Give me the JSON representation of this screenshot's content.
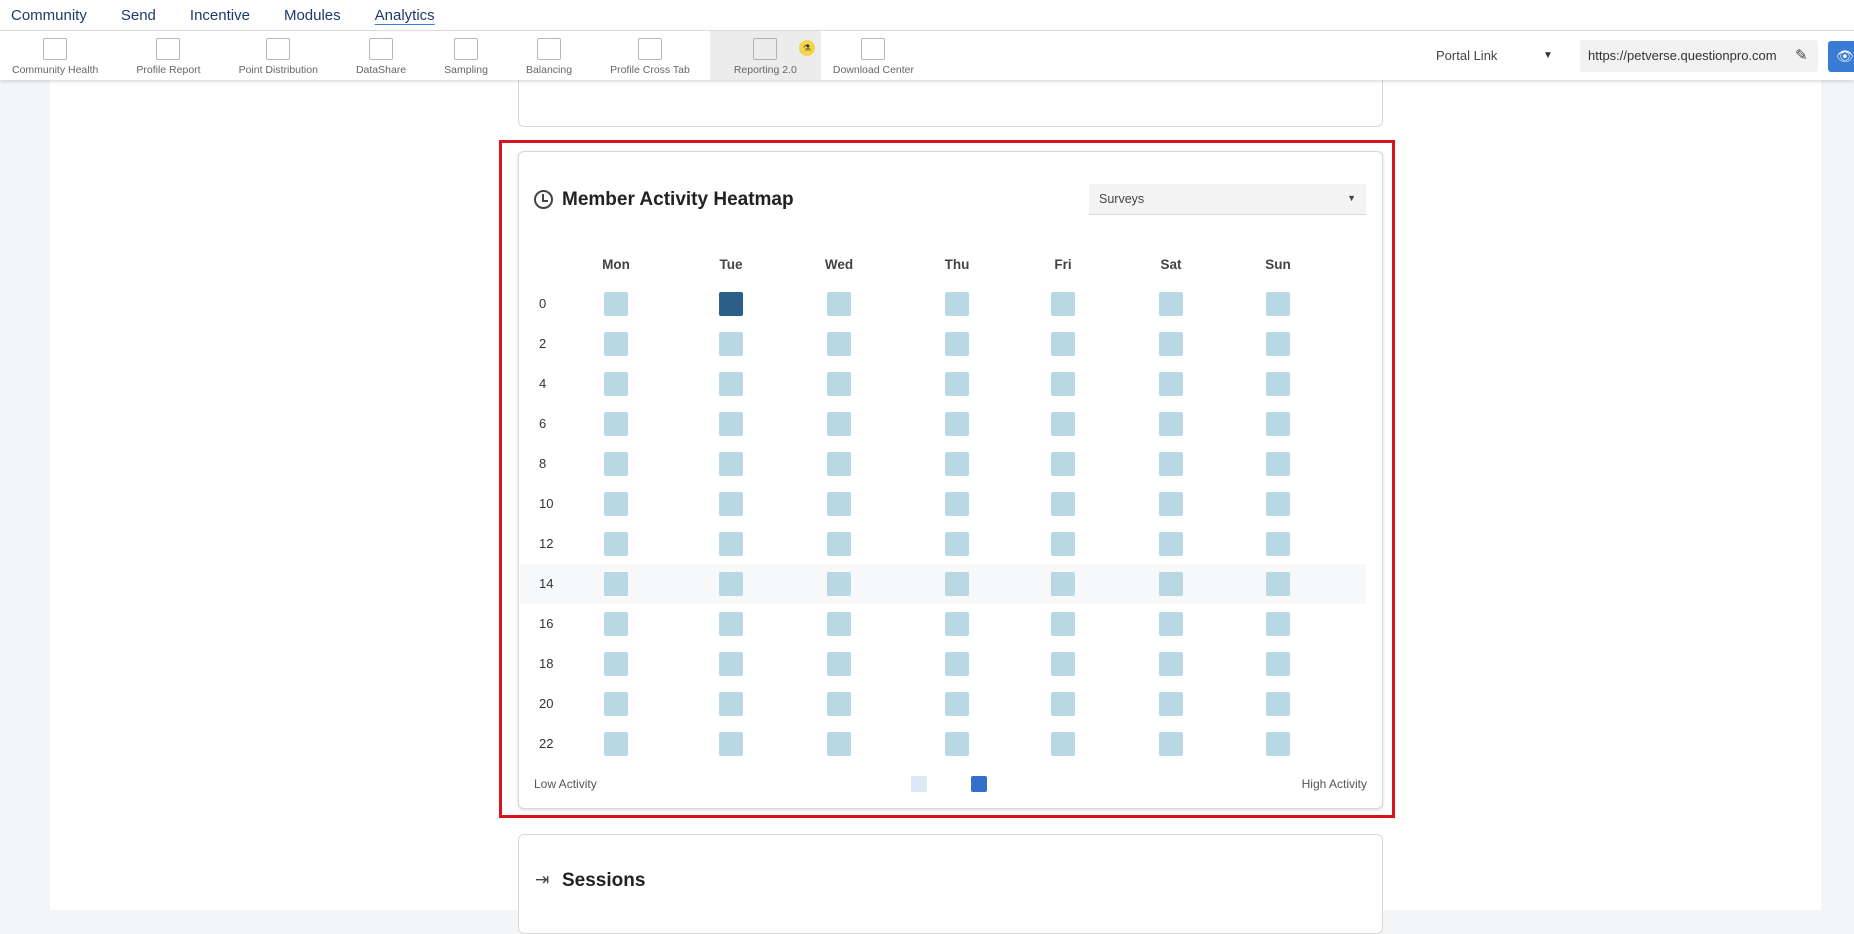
{
  "topnav": {
    "items": [
      "Community",
      "Send",
      "Incentive",
      "Modules",
      "Analytics"
    ],
    "active": "Analytics"
  },
  "toolbar": {
    "items": [
      "Community Health",
      "Profile Report",
      "Point Distribution",
      "DataShare",
      "Sampling",
      "Balancing",
      "Profile Cross Tab",
      "Reporting 2.0",
      "Download Center"
    ],
    "active": "Reporting 2.0"
  },
  "portal": {
    "label": "Portal Link",
    "url": "https://petverse.questionpro.com"
  },
  "heatmap_card": {
    "title": "Member Activity Heatmap",
    "select_value": "Surveys"
  },
  "sessions_card": {
    "title": "Sessions"
  },
  "chart_data": {
    "type": "heatmap",
    "title": "Member Activity Heatmap",
    "x": [
      "Mon",
      "Tue",
      "Wed",
      "Thu",
      "Fri",
      "Sat",
      "Sun"
    ],
    "y": [
      "0",
      "2",
      "4",
      "6",
      "8",
      "10",
      "12",
      "14",
      "16",
      "18",
      "20",
      "22"
    ],
    "values": [
      [
        0,
        1,
        0,
        0,
        0,
        0,
        0
      ],
      [
        0,
        0,
        0,
        0,
        0,
        0,
        0
      ],
      [
        0,
        0,
        0,
        0,
        0,
        0,
        0
      ],
      [
        0,
        0,
        0,
        0,
        0,
        0,
        0
      ],
      [
        0,
        0,
        0,
        0,
        0,
        0,
        0
      ],
      [
        0,
        0,
        0,
        0,
        0,
        0,
        0
      ],
      [
        0,
        0,
        0,
        0,
        0,
        0,
        0
      ],
      [
        0,
        0,
        0,
        0,
        0,
        0,
        0
      ],
      [
        0,
        0,
        0,
        0,
        0,
        0,
        0
      ],
      [
        0,
        0,
        0,
        0,
        0,
        0,
        0
      ],
      [
        0,
        0,
        0,
        0,
        0,
        0,
        0
      ],
      [
        0,
        0,
        0,
        0,
        0,
        0,
        0
      ]
    ],
    "colors": {
      "low": "#b8d9e3",
      "high": "#2a5f87"
    },
    "legend": {
      "low_label": "Low Activity",
      "high_label": "High Activity",
      "low_color": "#dce8f7",
      "high_color": "#3470c9"
    }
  }
}
